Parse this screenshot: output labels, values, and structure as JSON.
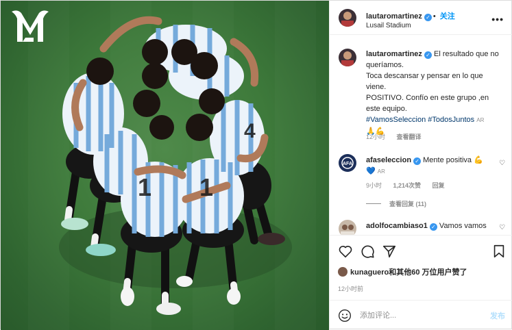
{
  "post": {
    "author": "lautaromartinez",
    "follow_label": "关注",
    "location": "Lusail Stadium",
    "more_label": "•••"
  },
  "caption": {
    "author": "lautaromartinez",
    "lines": [
      "El resultado que no queríamos.",
      "Toca descansar y pensar en lo que viene.",
      "POSITIVO. Confío en este grupo ,en este equipo."
    ],
    "hashtags": "#VamosSeleccion #TodosJuntos",
    "ar_tag": "AR",
    "emojis": "🙏💪",
    "time": "12小时",
    "translate_label": "查看翻译"
  },
  "comments": [
    {
      "author": "afaseleccion",
      "text": "Mente positiva 💪",
      "line2_emoji": "💙",
      "ar_tag": "AR",
      "time": "9小时",
      "likes": "1,214次赞",
      "reply_label": "回复",
      "view_replies": "查看回复 (11)"
    },
    {
      "author": "adolfocambiaso1",
      "text": "Vamos vamos"
    }
  ],
  "actions": {
    "icons": [
      "heart-icon",
      "comment-icon",
      "share-icon",
      "bookmark-icon"
    ],
    "likes_text": "kunaguero和其他60 万位用户赞了",
    "time": "12小时前"
  },
  "composer": {
    "placeholder": "添加评论...",
    "post_label": "发布"
  },
  "colors": {
    "link_blue": "#0095f6",
    "verified_blue": "#3897f0",
    "hashtag": "#00376b",
    "pitch_green": "#3e7a3b",
    "argentina_sky": "#75aadb"
  }
}
